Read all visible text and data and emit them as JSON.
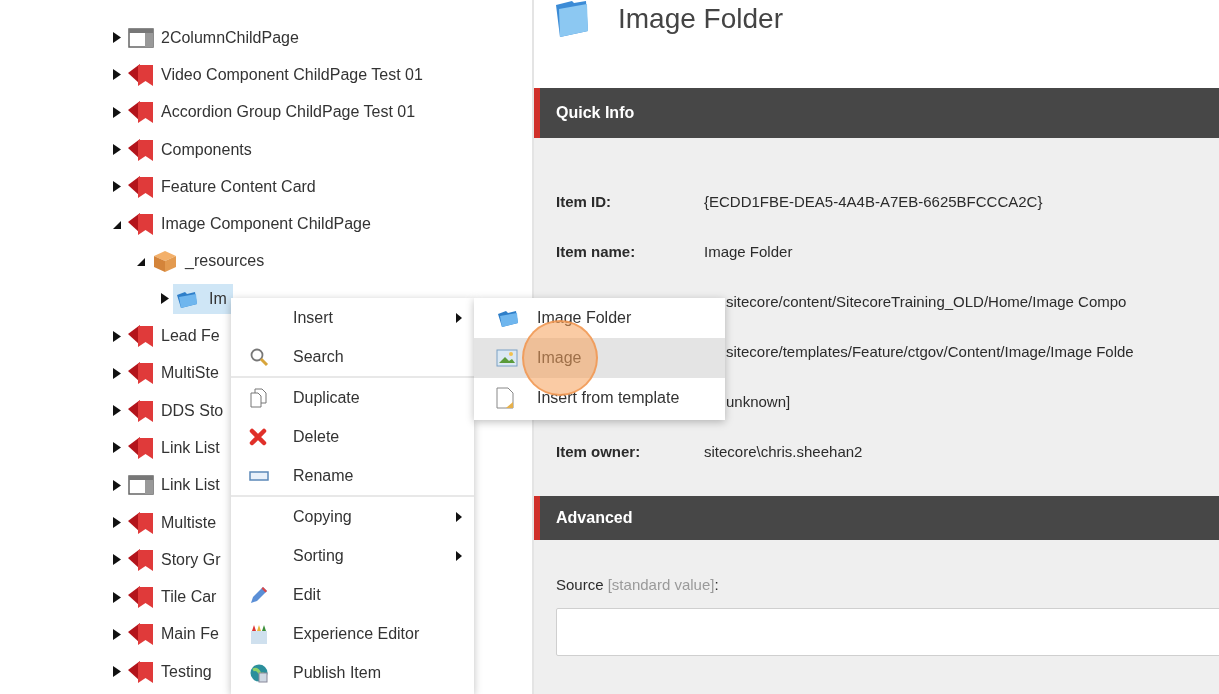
{
  "tree": [
    {
      "label": "2ColumnChildPage",
      "kind": "template",
      "expanded": false,
      "selected": false
    },
    {
      "label": "Video Component ChildPage Test 01",
      "kind": "page",
      "expanded": false,
      "selected": false
    },
    {
      "label": "Accordion Group ChildPage Test 01",
      "kind": "page",
      "expanded": false,
      "selected": false
    },
    {
      "label": "Components",
      "kind": "page",
      "expanded": false,
      "selected": false
    },
    {
      "label": "Feature Content Card",
      "kind": "page",
      "expanded": false,
      "selected": false
    },
    {
      "label": "Image Component ChildPage",
      "kind": "page",
      "expanded": true,
      "selected": false,
      "children": [
        {
          "label": "_resources",
          "kind": "box",
          "expanded": true,
          "selected": false,
          "children": [
            {
              "label": "Im",
              "kind": "folder",
              "expanded": false,
              "selected": true
            }
          ]
        }
      ]
    },
    {
      "label": "Lead Fe",
      "kind": "page",
      "expanded": false,
      "selected": false
    },
    {
      "label": "MultiSte",
      "kind": "page",
      "expanded": false,
      "selected": false
    },
    {
      "label": "DDS Sto",
      "kind": "page",
      "expanded": false,
      "selected": false
    },
    {
      "label": "Link List",
      "kind": "page",
      "expanded": false,
      "selected": false
    },
    {
      "label": "Link List",
      "kind": "template",
      "expanded": false,
      "selected": false
    },
    {
      "label": "Multiste",
      "kind": "page",
      "expanded": false,
      "selected": false
    },
    {
      "label": "Story Gr",
      "kind": "page",
      "expanded": false,
      "selected": false
    },
    {
      "label": "Tile Car",
      "kind": "page",
      "expanded": false,
      "selected": false
    },
    {
      "label": "Main Fe",
      "kind": "page",
      "expanded": false,
      "selected": false
    },
    {
      "label": "Testing",
      "kind": "page",
      "expanded": false,
      "selected": false
    }
  ],
  "context_menu": {
    "groups": [
      [
        {
          "label": "Insert",
          "kind": "plain",
          "submenu": true
        },
        {
          "label": "Search",
          "kind": "search",
          "submenu": false
        }
      ],
      [
        {
          "label": "Duplicate",
          "kind": "duplicate",
          "submenu": false
        },
        {
          "label": "Delete",
          "kind": "delete",
          "submenu": false
        },
        {
          "label": "Rename",
          "kind": "rename",
          "submenu": false
        }
      ],
      [
        {
          "label": "Copying",
          "kind": "plain",
          "submenu": true
        },
        {
          "label": "Sorting",
          "kind": "plain",
          "submenu": true
        },
        {
          "label": "Edit",
          "kind": "edit",
          "submenu": false
        },
        {
          "label": "Experience Editor",
          "kind": "experience",
          "submenu": false
        },
        {
          "label": "Publish Item",
          "kind": "publish",
          "submenu": false
        }
      ]
    ]
  },
  "submenu": {
    "items": [
      {
        "label": "Image Folder",
        "kind": "folder",
        "selected": false
      },
      {
        "label": "Image",
        "kind": "image",
        "selected": true
      },
      {
        "label": "Insert from template",
        "kind": "template",
        "selected": false
      }
    ]
  },
  "item": {
    "title": "Image Folder",
    "quick_info": {
      "title": "Quick Info",
      "fields": [
        {
          "kind": "full",
          "label": "Item ID:",
          "value": "{ECDD1FBE-DEA5-4A4B-A7EB-6625BFCCCA2C}"
        },
        {
          "kind": "full",
          "label": "Item name:",
          "value": "Image Folder"
        },
        {
          "kind": "partial",
          "value": "sitecore/content/SitecoreTraining_OLD/Home/Image Compo"
        },
        {
          "kind": "partial",
          "value": "sitecore/templates/Feature/ctgov/Content/Image/Image Folde"
        },
        {
          "kind": "partial",
          "value": "unknown]"
        },
        {
          "kind": "full",
          "label": "Item owner:",
          "value": "sitecore\\chris.sheehan2"
        }
      ]
    },
    "advanced": {
      "title": "Advanced",
      "field_label": "Source",
      "field_hint": "[standard value]",
      "field_suffix": ":"
    }
  }
}
